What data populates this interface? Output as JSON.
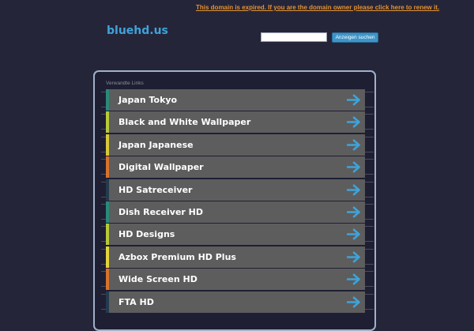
{
  "header": {
    "notice": "This domain is expired. If you are the domain owner please click here to renew it.",
    "logo": "bluehd.us"
  },
  "search": {
    "value": "",
    "button_label": "Anzeigen suchen"
  },
  "related": {
    "title": "Verwandte Links",
    "items": [
      {
        "label": "Japan Tokyo",
        "accent": "#2a8a78"
      },
      {
        "label": "Black and White Wallpaper",
        "accent": "#b9c93a"
      },
      {
        "label": "Japan Japanese",
        "accent": "#d8c93a"
      },
      {
        "label": "Digital Wallpaper",
        "accent": "#d8722a"
      },
      {
        "label": "HD Satreceiver",
        "accent": "#243a4e"
      },
      {
        "label": "Dish Receiver HD",
        "accent": "#2a8a78"
      },
      {
        "label": "HD Designs",
        "accent": "#b9c93a"
      },
      {
        "label": "Azbox Premium HD Plus",
        "accent": "#e3d43a"
      },
      {
        "label": "Wide Screen HD",
        "accent": "#d8722a"
      },
      {
        "label": "FTA HD",
        "accent": "#243a4e"
      }
    ]
  },
  "colors": {
    "background": "#25253a",
    "link_bg": "#5d5d5e",
    "arrow": "#3fa3d8",
    "notice": "#e3922e"
  },
  "icons": {
    "arrow": "arrow-right-icon"
  }
}
